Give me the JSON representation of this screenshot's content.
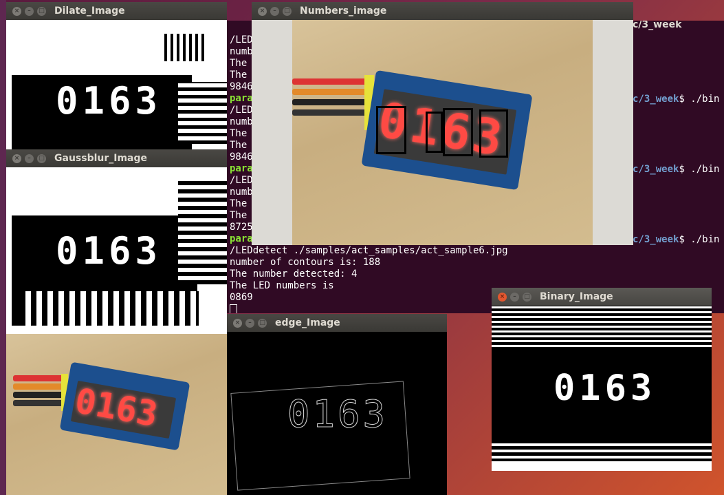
{
  "windows": {
    "dilate": {
      "title": "Dilate_Image",
      "digits": "0163"
    },
    "gauss": {
      "title": "Gaussblur_Image",
      "digits": "0163"
    },
    "numbers": {
      "title": "Numbers_image",
      "digits": "0163"
    },
    "edge": {
      "title": "edge_Image",
      "digits": "0163"
    },
    "binary": {
      "title": "Binary_Image",
      "digits": "0163"
    },
    "source": {
      "digits": "0163"
    }
  },
  "terminal": {
    "title_fragment": "c/3_week",
    "lines": [
      {
        "text": "/LED",
        "color": "white"
      },
      {
        "text": "numb",
        "color": "white"
      },
      {
        "text": "The ",
        "color": "white"
      },
      {
        "text": "The ",
        "color": "white"
      },
      {
        "text": "9846",
        "color": "white"
      },
      {
        "text": "para",
        "color": "green"
      },
      {
        "text": "/LED",
        "color": "white"
      },
      {
        "text": "numb",
        "color": "white"
      },
      {
        "text": "The ",
        "color": "white"
      },
      {
        "text": "The ",
        "color": "white"
      },
      {
        "text": "9846",
        "color": "white"
      },
      {
        "text": "para",
        "color": "green"
      },
      {
        "text": "/LED",
        "color": "white"
      },
      {
        "text": "numb",
        "color": "white"
      },
      {
        "text": "The ",
        "color": "white"
      },
      {
        "text": "The ",
        "color": "white"
      },
      {
        "text": "8725",
        "color": "white"
      },
      {
        "text": "para",
        "color": "green"
      },
      {
        "text": "/LEDdetect ./samples/act_samples/act_sample6.jpg",
        "color": "white"
      },
      {
        "text": "number of contours is: 188",
        "color": "white"
      },
      {
        "text": "The number detected: 4",
        "color": "white"
      },
      {
        "text": "The LED numbers is",
        "color": "white"
      },
      {
        "text": "0869",
        "color": "white"
      }
    ],
    "right_prompts": [
      {
        "path": "c/3_week",
        "cmd": "$ ./bin"
      },
      {
        "path": "c/3_week",
        "cmd": "$ ./bin"
      },
      {
        "path": "c/3_week",
        "cmd": "$ ./bin"
      }
    ]
  },
  "colors": {
    "terminal_bg": "#300a24",
    "close_active": "#e2572f",
    "led_red": "#ff4a44",
    "board_blue": "#1c4f8e"
  }
}
